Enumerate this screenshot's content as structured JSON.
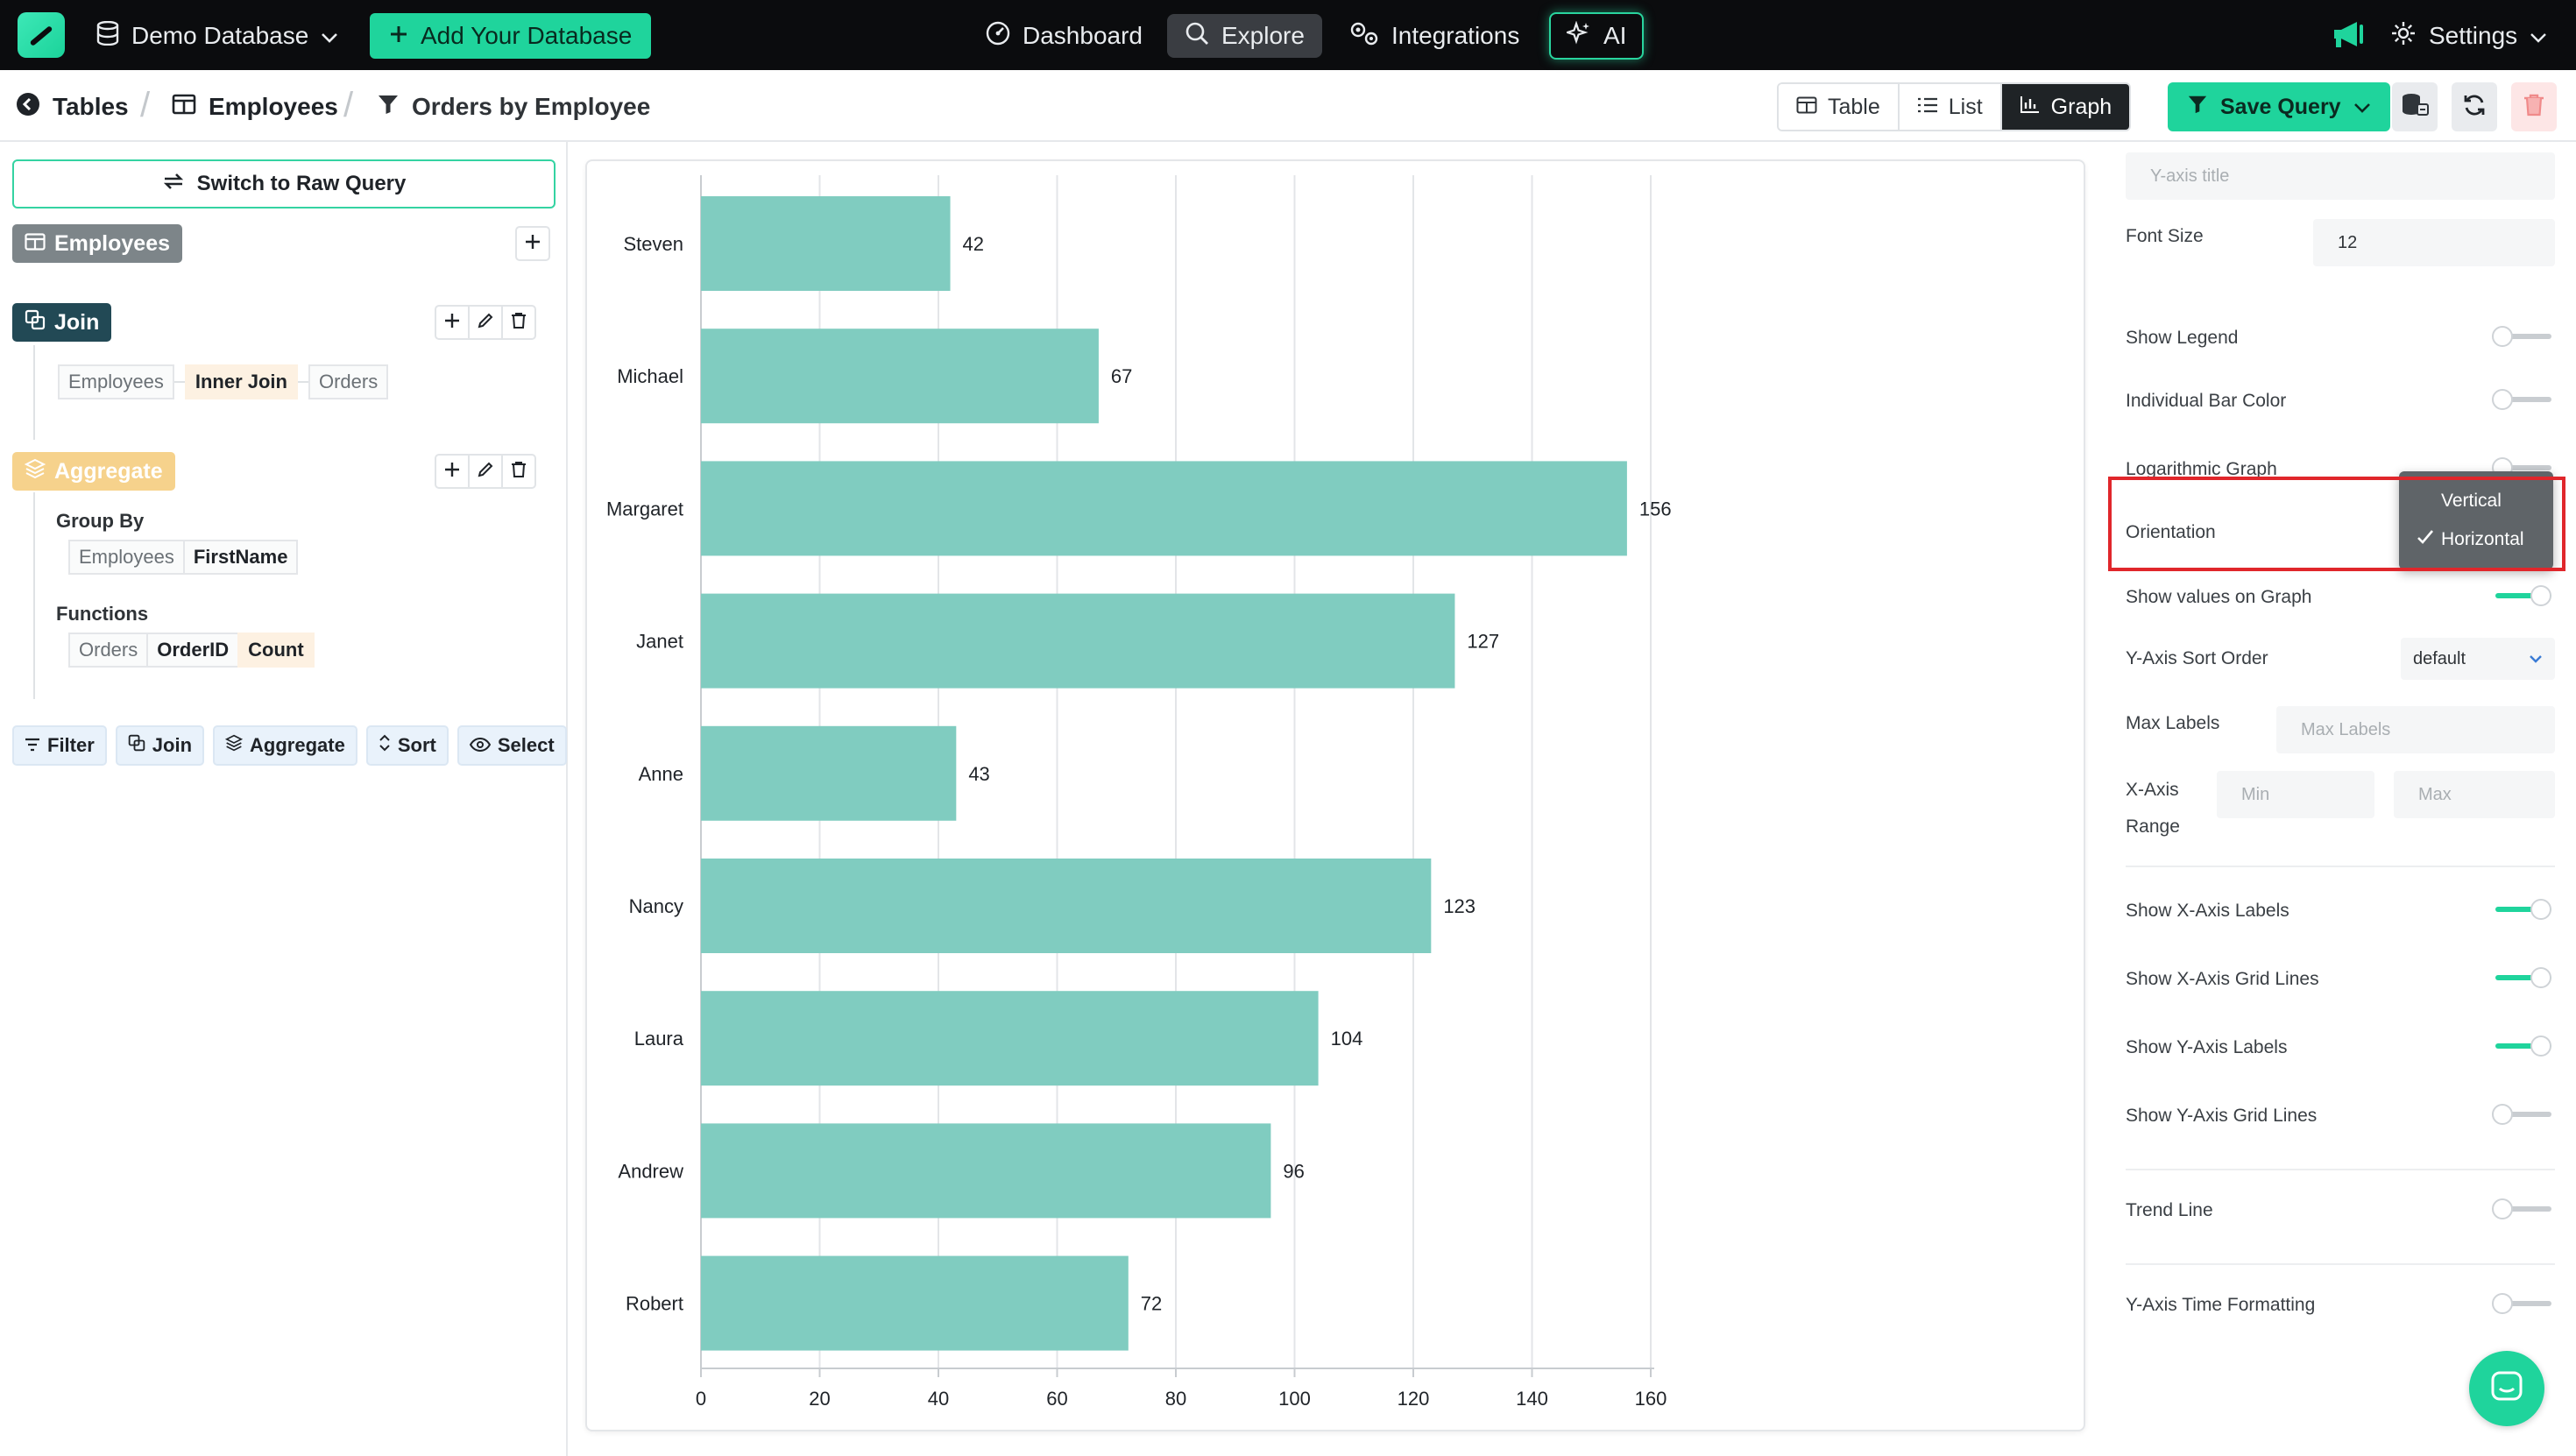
{
  "topnav": {
    "database_label": "Demo Database",
    "add_database_label": "Add Your Database",
    "dashboard_label": "Dashboard",
    "explore_label": "Explore",
    "integrations_label": "Integrations",
    "ai_label": "AI",
    "settings_label": "Settings"
  },
  "breadcrumb": {
    "tables": "Tables",
    "employees": "Employees",
    "query": "Orders by Employee"
  },
  "view_toggle": {
    "table": "Table",
    "list": "List",
    "graph": "Graph",
    "active": "graph"
  },
  "toolbar": {
    "save_query_label": "Save Query"
  },
  "builder": {
    "raw_query_label": "Switch to Raw Query",
    "source_table": "Employees",
    "join": {
      "badge": "Join",
      "left": "Employees",
      "type": "Inner Join",
      "right": "Orders"
    },
    "aggregate": {
      "badge": "Aggregate",
      "group_by_label": "Group By",
      "group_by_table": "Employees",
      "group_by_column": "FirstName",
      "functions_label": "Functions",
      "function_table": "Orders",
      "function_column": "OrderID",
      "function_name": "Count"
    },
    "tools": {
      "filter": "Filter",
      "join": "Join",
      "aggregate": "Aggregate",
      "sort": "Sort",
      "select": "Select"
    }
  },
  "chart_data": {
    "type": "bar",
    "orientation": "horizontal",
    "categories": [
      "Steven",
      "Michael",
      "Margaret",
      "Janet",
      "Anne",
      "Nancy",
      "Laura",
      "Andrew",
      "Robert"
    ],
    "values": [
      42,
      67,
      156,
      127,
      43,
      123,
      104,
      96,
      72
    ],
    "xlim": [
      0,
      160
    ],
    "xticks": [
      0,
      20,
      40,
      60,
      80,
      100,
      120,
      140,
      160
    ],
    "show_values": true,
    "x_grid": true,
    "y_grid": false,
    "bar_color": "#80ccc0"
  },
  "settings_panel": {
    "y_axis_title_label": "Y-axis title",
    "y_axis_title_placeholder": "Y-axis title",
    "font_size_label": "Font Size",
    "font_size_value": "12",
    "show_legend_label": "Show Legend",
    "individual_bar_color_label": "Individual Bar Color",
    "logarithmic_label": "Logarithmic Graph",
    "orientation_label": "Orientation",
    "orientation_options": [
      "Vertical",
      "Horizontal"
    ],
    "orientation_selected": "Horizontal",
    "show_values_label": "Show values on Graph",
    "sort_order_label": "Y-Axis Sort Order",
    "sort_order_value": "default",
    "max_labels_label": "Max Labels",
    "max_labels_placeholder": "Max Labels",
    "x_range_label_1": "X-Axis",
    "x_range_label_2": "Range",
    "x_range_min_placeholder": "Min",
    "x_range_max_placeholder": "Max",
    "show_x_labels_label": "Show X-Axis Labels",
    "show_x_grid_label": "Show X-Axis Grid Lines",
    "show_y_labels_label": "Show Y-Axis Labels",
    "show_y_grid_label": "Show Y-Axis Grid Lines",
    "trend_line_label": "Trend Line",
    "time_format_label": "Y-Axis Time Formatting"
  },
  "colors": {
    "accent": "#1fd49c",
    "nav_bg": "#0b0c0e",
    "bar": "#80ccc0",
    "highlight": "#e0262b"
  }
}
